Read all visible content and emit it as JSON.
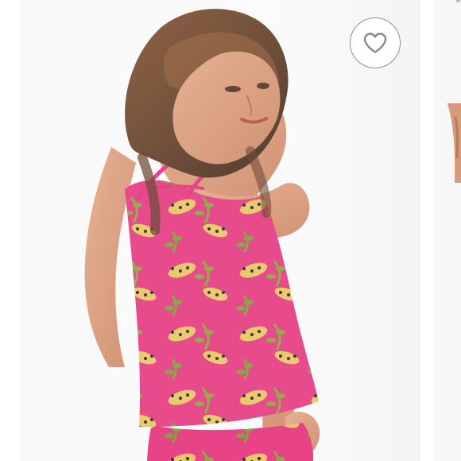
{
  "listing": {
    "photos": [
      {
        "alt": "",
        "print_colors": {
          "background": "#e73d83",
          "leopard": "#e8c763",
          "leaf": "#89a83c",
          "accent": "#2f2531"
        }
      },
      {
        "alt": ""
      }
    ],
    "like_button": {
      "icon": "heart-outline-icon",
      "stroke_color": "#8a8a8a"
    }
  }
}
